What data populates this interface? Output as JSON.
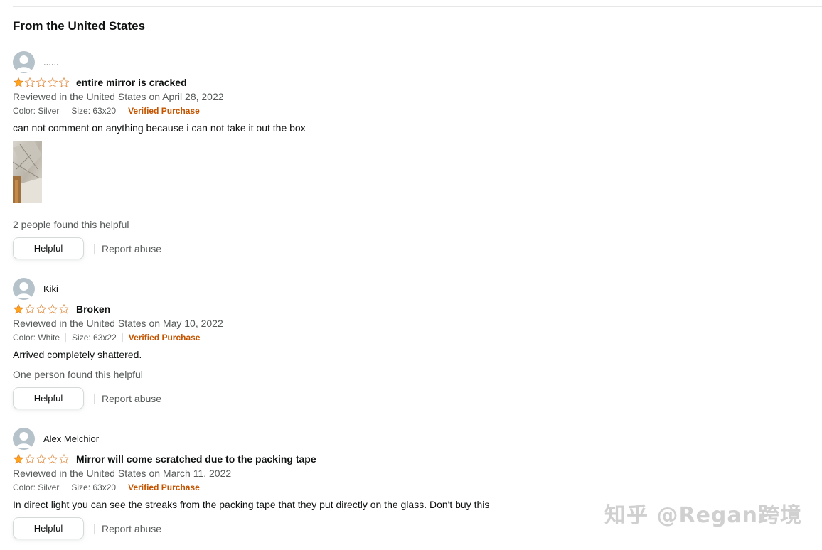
{
  "section": {
    "title": "From the United States"
  },
  "colors": {
    "star": "#ffa41c",
    "verified": "#c45500",
    "muted": "#565959"
  },
  "reviews": [
    {
      "author": "......",
      "rating": 1,
      "title": "entire mirror is cracked",
      "date": "Reviewed in the United States on April 28, 2022",
      "color": "Color: Silver",
      "size": "Size: 63x20",
      "verified": "Verified Purchase",
      "body": "can not comment on anything because i can not take it out the box",
      "helpful_count": "2 people found this helpful",
      "helpful_label": "Helpful",
      "report_label": "Report abuse"
    },
    {
      "author": "Kiki",
      "rating": 1,
      "title": "Broken",
      "date": "Reviewed in the United States on May 10, 2022",
      "color": "Color: White",
      "size": "Size: 63x22",
      "verified": "Verified Purchase",
      "body": "Arrived completely shattered.",
      "helpful_count": "One person found this helpful",
      "helpful_label": "Helpful",
      "report_label": "Report abuse"
    },
    {
      "author": "Alex Melchior",
      "rating": 1,
      "title": "Mirror will come scratched due to the packing tape",
      "date": "Reviewed in the United States on March 11, 2022",
      "color": "Color: Silver",
      "size": "Size: 63x20",
      "verified": "Verified Purchase",
      "body": "In direct light you can see the streaks from the packing tape that they put directly on the glass. Don't buy this",
      "helpful_label": "Helpful",
      "report_label": "Report abuse"
    }
  ],
  "watermark": "知乎 @Regan跨境"
}
